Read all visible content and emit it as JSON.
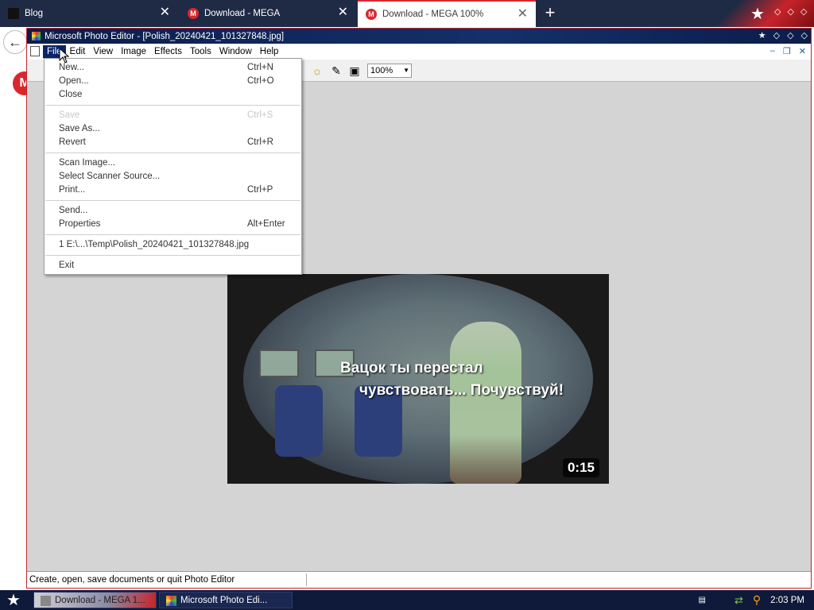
{
  "browser": {
    "tabs": [
      {
        "label": "Blog",
        "favicon": "blog-icon"
      },
      {
        "label": "Download - MEGA",
        "favicon": "mega-icon"
      },
      {
        "label": "Download - MEGA 100%",
        "favicon": "mega-icon"
      }
    ],
    "new_tab_icon": "plus-icon",
    "back_icon": "arrow-left-icon",
    "logo_letter": "M"
  },
  "editor": {
    "title": "Microsoft Photo Editor - [Polish_20240421_101327848.jpg]",
    "menu": [
      "File",
      "Edit",
      "View",
      "Image",
      "Effects",
      "Tools",
      "Window",
      "Help"
    ],
    "zoom": "100%",
    "status": "Create, open, save documents or quit Photo Editor"
  },
  "file_menu": {
    "groups": [
      [
        {
          "label": "New...",
          "shortcut": "Ctrl+N",
          "enabled": true
        },
        {
          "label": "Open...",
          "shortcut": "Ctrl+O",
          "enabled": true
        },
        {
          "label": "Close",
          "shortcut": "",
          "enabled": true
        }
      ],
      [
        {
          "label": "Save",
          "shortcut": "Ctrl+S",
          "enabled": false
        },
        {
          "label": "Save As...",
          "shortcut": "",
          "enabled": true
        },
        {
          "label": "Revert",
          "shortcut": "Ctrl+R",
          "enabled": true
        }
      ],
      [
        {
          "label": "Scan Image...",
          "shortcut": "",
          "enabled": true
        },
        {
          "label": "Select Scanner Source...",
          "shortcut": "",
          "enabled": true
        },
        {
          "label": "Print...",
          "shortcut": "Ctrl+P",
          "enabled": true
        }
      ],
      [
        {
          "label": "Send...",
          "shortcut": "",
          "enabled": true
        },
        {
          "label": "Properties",
          "shortcut": "Alt+Enter",
          "enabled": true
        }
      ],
      [
        {
          "label": "1 E:\\...\\Temp\\Polish_20240421_101327848.jpg",
          "shortcut": "",
          "enabled": true
        }
      ],
      [
        {
          "label": "Exit",
          "shortcut": "",
          "enabled": true
        }
      ]
    ]
  },
  "image": {
    "caption_line1": "Вацок ты перестал",
    "caption_line2": "чувствовать... Почувствуй!",
    "duration": "0:15"
  },
  "taskbar": {
    "tasks": [
      "Download - MEGA 1...",
      "Microsoft Photo Edi..."
    ],
    "clock": "2:03 PM"
  },
  "colors": {
    "titlebar": "#0b1d4a",
    "menu_highlight": "#0a246a",
    "mega_red": "#d9272e"
  }
}
